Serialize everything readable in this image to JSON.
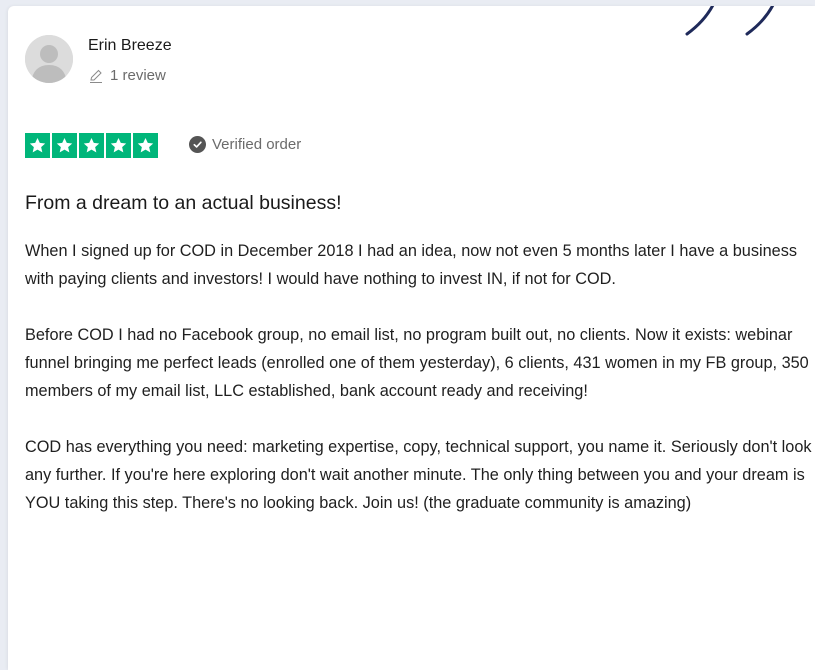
{
  "review": {
    "reviewer_name": "Erin Breeze",
    "review_count": "1 review",
    "rating": 5,
    "verified_label": "Verified order",
    "title": "From a dream to an actual business!",
    "paragraphs": [
      "When I signed up for COD in December 2018 I had an idea, now not even 5 months later I have a business with paying clients and investors! I would have nothing to invest IN, if not for COD.",
      "Before COD I had no Facebook group, no email list, no program built out, no clients. Now it exists: webinar funnel bringing me perfect leads (enrolled one of them yesterday), 6 clients, 431 women in my FB group, 350 members of my email list, LLC established, bank account ready and receiving!",
      "COD has everything you need: marketing expertise, copy, technical support, you name it. Seriously don't look any further. If you're here exploring don't wait another minute. The only thing between you and your dream is YOU taking this step. There's no looking back. Join us! (the graduate community is amazing)"
    ]
  },
  "colors": {
    "star_green": "#00b67a",
    "check_gray": "#555555",
    "deco_navy": "#1f2a5a"
  },
  "icons": {
    "avatar": "user-avatar-placeholder",
    "review_count": "pencil-icon",
    "star": "star-icon",
    "verified": "checkmark-circle-icon"
  }
}
